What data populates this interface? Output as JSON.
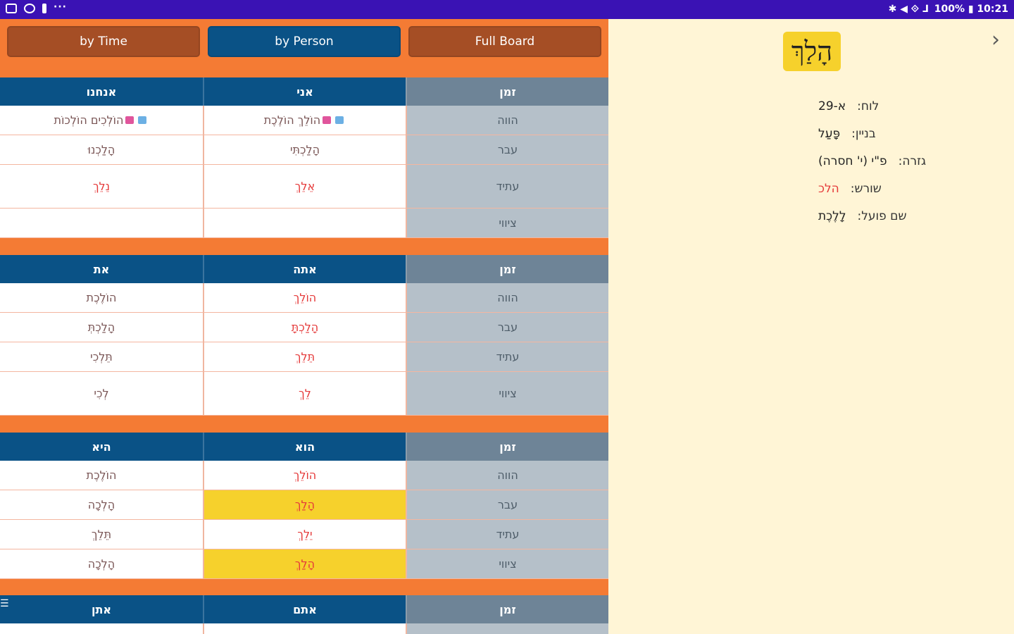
{
  "statusbar": {
    "left_icons": [
      "gallery-icon",
      "alarm-icon",
      "battery-saver-icon"
    ],
    "more": "···",
    "right_text": "100% ▮ 10:21",
    "right_icons_text": "✱ ◀ ⟐ ⅃"
  },
  "nav": {
    "by_time": "by Time",
    "by_person": "by Person",
    "full_board": "Full Board"
  },
  "blocks": [
    {
      "headers": [
        "אנחנו",
        "אני",
        "זמן"
      ],
      "rows": [
        {
          "c1": "הוֹלְכִים הוֹלְכוֹת",
          "c1_icons": true,
          "c2": "הוֹלֵךְ הוֹלֶכֶת",
          "c2_icons": true,
          "c3": "הווה",
          "tall": false
        },
        {
          "c1": "הָלַכְנוּ",
          "c2": "הָלַכְתִּי",
          "c3": "עבר",
          "tall": false
        },
        {
          "c1": "נֵלֵךְ",
          "c2": "אֵלֵךְ",
          "c3": "עתיד",
          "tall": true,
          "red": true
        },
        {
          "c1": "",
          "c2": "",
          "c3": "ציווי",
          "tall": false
        }
      ]
    },
    {
      "headers": [
        "את",
        "אתה",
        "זמן"
      ],
      "rows": [
        {
          "c1": "הוֹלֶכֶת",
          "c2": "הוֹלֵךְ",
          "c3": "הווה",
          "c2red": true
        },
        {
          "c1": "הָלַכְתְּ",
          "c2": "הָלַכְתָּ",
          "c3": "עבר",
          "c2red": true
        },
        {
          "c1": "תֵּלְכִי",
          "c2": "תֵּלֵךְ",
          "c3": "עתיד",
          "c2red": true
        },
        {
          "c1": "לְכִי",
          "c2": "לֵךְ",
          "c3": "ציווי",
          "tall": true,
          "c2red": true
        }
      ]
    },
    {
      "headers": [
        "היא",
        "הוא",
        "זמן"
      ],
      "rows": [
        {
          "c1": "הוֹלֶכֶת",
          "c2": "הוֹלֵךְ",
          "c3": "הווה",
          "c2red": true
        },
        {
          "c1": "הָלְכָה",
          "c2": "הָלַךְ",
          "c3": "עבר",
          "c2red": true,
          "c2yellow": true
        },
        {
          "c1": "תֵּלֵךְ",
          "c2": "יֵלֵךְ",
          "c3": "עתיד",
          "c2red": true
        },
        {
          "c1": "הָלְכָה",
          "c2": "הָלַךְ",
          "c3": "ציווי",
          "c2red": true,
          "c2yellow": true
        }
      ]
    },
    {
      "headers": [
        "אתן",
        "אתם",
        "זמן"
      ],
      "rows": []
    }
  ],
  "panel": {
    "word": "הָלַךְ",
    "fields": [
      {
        "label": "לוח:",
        "value": "א-29"
      },
      {
        "label": "בניין:",
        "value": "פָּעַל"
      },
      {
        "label": "גזרה:",
        "value": "פ\"י (י' חסרה)"
      },
      {
        "label": "שורש:",
        "value": "הלכ",
        "red": true
      },
      {
        "label": "שם פועל:",
        "value": "לָלֶכֶת"
      }
    ]
  }
}
